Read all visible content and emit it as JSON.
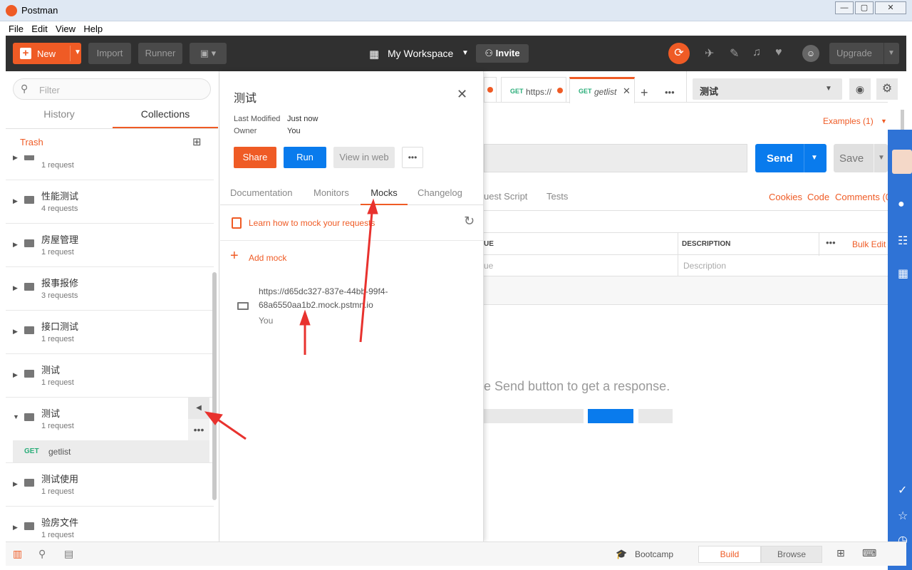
{
  "window": {
    "title": "Postman",
    "min": "—",
    "max": "▢",
    "close": "✕"
  },
  "menu": [
    "File",
    "Edit",
    "View",
    "Help"
  ],
  "toolbar": {
    "new_label": "New",
    "import_label": "Import",
    "runner_label": "Runner",
    "workspace_label": "My Workspace",
    "invite_label": "Invite",
    "upgrade_label": "Upgrade"
  },
  "sidebar": {
    "filter_placeholder": "Filter",
    "tabs": {
      "history": "History",
      "collections": "Collections"
    },
    "trash_label": "Trash",
    "collections": [
      {
        "name": "",
        "count": "1 request"
      },
      {
        "name": "性能测试",
        "count": "4 requests"
      },
      {
        "name": "房屋管理",
        "count": "1 request"
      },
      {
        "name": "报事报修",
        "count": "3 requests"
      },
      {
        "name": "接口测试",
        "count": "1 request"
      },
      {
        "name": "测试",
        "count": "1 request"
      },
      {
        "name": "测试",
        "count": "1 request"
      },
      {
        "name": "测试使用",
        "count": "1 request"
      },
      {
        "name": "验房文件",
        "count": "1 request"
      }
    ],
    "open_request": {
      "method": "GET",
      "name": "getlist"
    }
  },
  "drawer": {
    "title": "测试",
    "last_modified_label": "Last Modified",
    "last_modified_value": "Just now",
    "owner_label": "Owner",
    "owner_value": "You",
    "share_label": "Share",
    "run_label": "Run",
    "view_web_label": "View in web",
    "tabs": [
      "Documentation",
      "Monitors",
      "Mocks",
      "Changelog"
    ],
    "learn_link": "Learn how to mock your requests",
    "add_mock_label": "Add mock",
    "mock_url_line1": "https://d65dc327-837e-44bb-99f4-",
    "mock_url_line2": "68a6550aa1b2.mock.pstmn.io",
    "mock_owner": "You"
  },
  "main": {
    "tab1_method": "GET",
    "tab1_url": "https://",
    "tab2_method": "GET",
    "tab2_name": "getlist",
    "env_label": "测试",
    "examples_label": "Examples (1)",
    "send_label": "Send",
    "save_label": "Save",
    "script_tab": "uest Script",
    "tests_tab": "Tests",
    "cookies_link": "Cookies",
    "code_link": "Code",
    "comments_link": "Comments (0",
    "col_value": "UE",
    "col_description": "DESCRIPTION",
    "bulk_edit": "Bulk Edit",
    "value_placeholder": "ue",
    "description_placeholder": "Description",
    "hint": "e Send button to get a response."
  },
  "statusbar": {
    "bootcamp_label": "Bootcamp",
    "build_label": "Build",
    "browse_label": "Browse"
  },
  "colors": {
    "accent": "#ef5b25",
    "primary": "#097bed",
    "arrow": "#e8322e"
  }
}
